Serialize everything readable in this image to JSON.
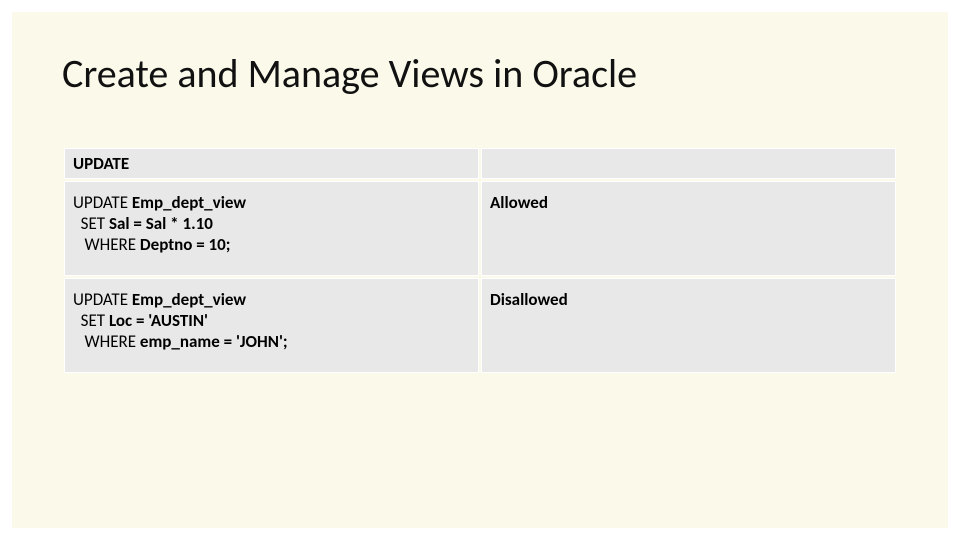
{
  "title": "Create and Manage Views in Oracle",
  "table": {
    "header": {
      "col1": "UPDATE",
      "col2": ""
    },
    "rows": [
      {
        "sql": {
          "l1a": "UPDATE ",
          "l1b": "Emp_dept_view",
          "l2a": "  SET ",
          "l2b": "Sal = Sal * 1.10",
          "l3a": "   WHERE ",
          "l3b": "Deptno = 10;"
        },
        "status": "Allowed"
      },
      {
        "sql": {
          "l1a": "UPDATE ",
          "l1b": "Emp_dept_view",
          "l2a": "  SET ",
          "l2b": "Loc = 'AUSTIN'",
          "l3a": "   WHERE ",
          "l3b": "emp_name = 'JOHN';"
        },
        "status": "Disallowed"
      }
    ]
  }
}
